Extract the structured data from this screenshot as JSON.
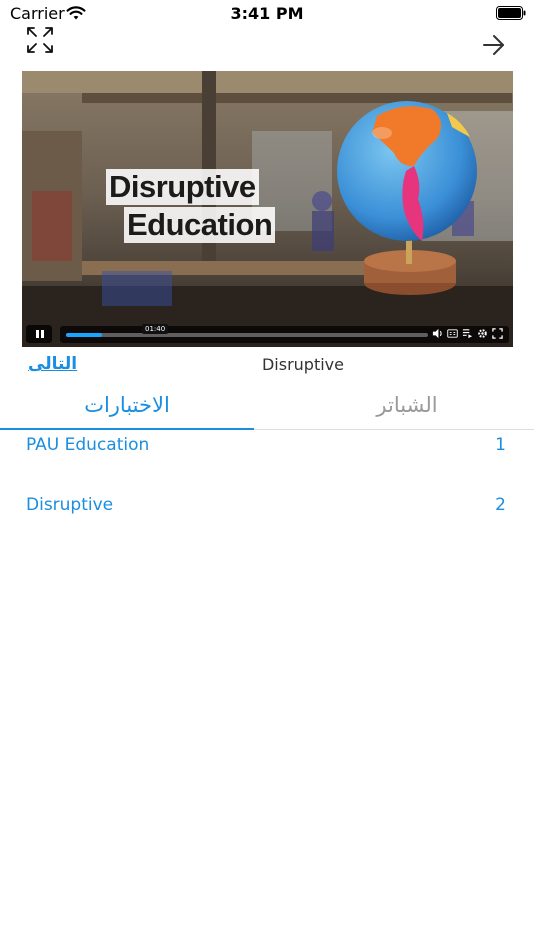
{
  "status_bar": {
    "carrier": "Carrier",
    "time": "3:41 PM"
  },
  "nav": {
    "expand_icon": "expand-arrows-icon",
    "forward_icon": "arrow-right-icon"
  },
  "video": {
    "title_line1": "Disruptive",
    "title_line2": "Education",
    "current_time": "01:40",
    "progress": 0.1,
    "state": "playing"
  },
  "info": {
    "next_label": "التالى",
    "video_name": "Disruptive"
  },
  "tabs": [
    {
      "label": "الاختبارات",
      "active": true
    },
    {
      "label": "الشباتر",
      "active": false
    }
  ],
  "items": [
    {
      "number": "1",
      "title": "PAU Education"
    },
    {
      "number": "2",
      "title": "Disruptive"
    }
  ],
  "colors": {
    "accent": "#1a8ee0",
    "inactive_tab": "#9a9a9a"
  }
}
